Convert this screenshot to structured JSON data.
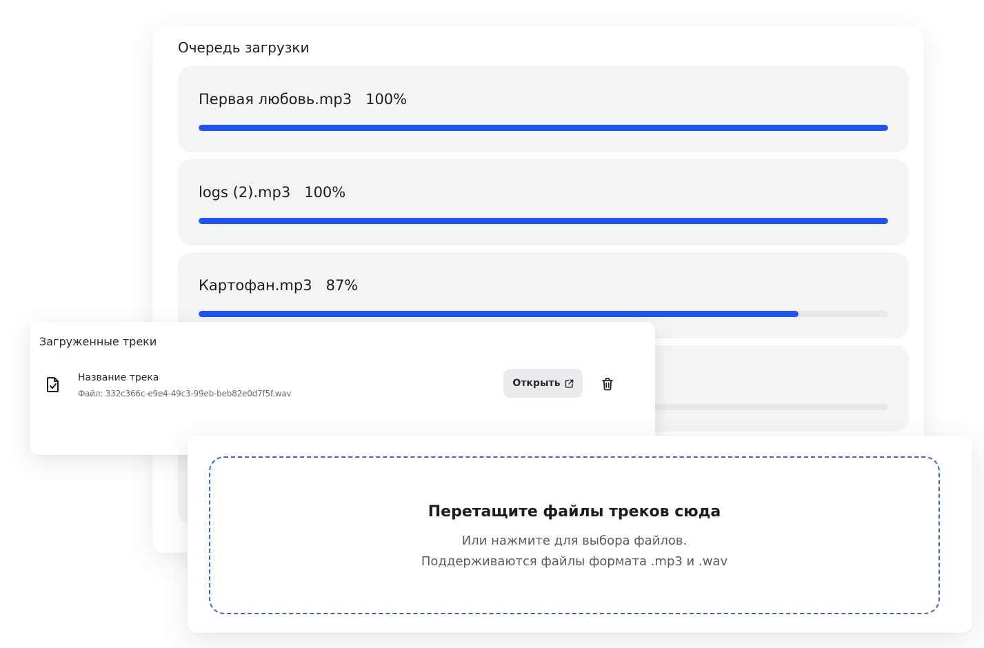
{
  "queue": {
    "title": "Очередь загрузки",
    "items": [
      {
        "name": "Первая любовь.mp3",
        "percent_label": "100%",
        "progress": 100
      },
      {
        "name": "logs (2).mp3",
        "percent_label": "100%",
        "progress": 100
      },
      {
        "name": "Картофан.mp3",
        "percent_label": "87%",
        "progress": 87
      }
    ]
  },
  "uploaded": {
    "title": "Загруженные треки",
    "tracks": [
      {
        "name": "Название трека",
        "file": "Файл: 332c366c-e9e4-49c3-99eb-beb82e0d7f5f.wav",
        "open_label": "Открыть"
      }
    ]
  },
  "dropzone": {
    "title": "Перетащите файлы треков сюда",
    "line1": "Или нажмите для выбора файлов.",
    "line2": "Поддерживаются файлы формата .mp3 и .wav"
  },
  "colors": {
    "accent": "#1f55f5",
    "dropzone_border": "#3b63e0",
    "item_bg": "#f4f4f5"
  },
  "icons": {
    "file": "file-check-icon",
    "open": "external-link-icon",
    "delete": "trash-icon"
  }
}
